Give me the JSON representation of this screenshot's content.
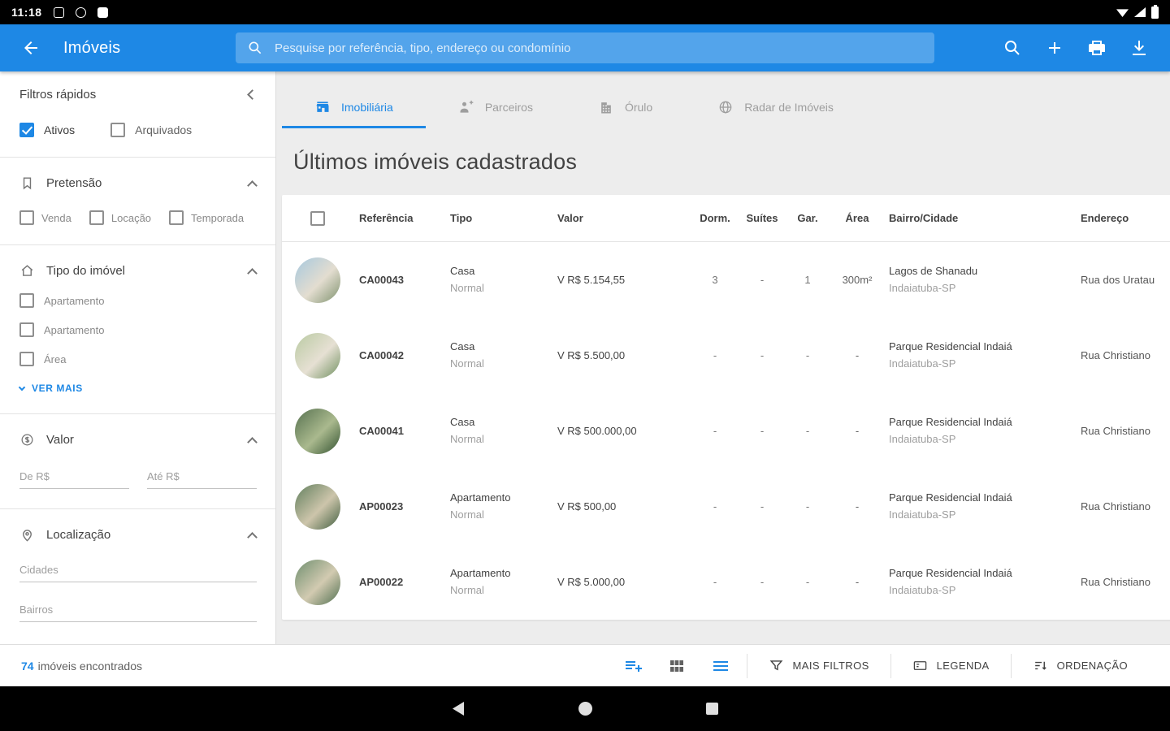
{
  "theme": {
    "accent": "#1e88e5",
    "bar_background": "#000000"
  },
  "status_bar": {
    "time": "11:18"
  },
  "app_bar": {
    "title": "Imóveis",
    "search_placeholder": "Pesquise por referência, tipo, endereço ou condomínio"
  },
  "sidebar": {
    "title": "Filtros rápidos",
    "quick_filters": [
      {
        "label": "Ativos",
        "checked": true
      },
      {
        "label": "Arquivados",
        "checked": false
      }
    ],
    "pretensao": {
      "title": "Pretensão",
      "options": [
        "Venda",
        "Locação",
        "Temporada"
      ]
    },
    "tipo_imovel": {
      "title": "Tipo do imóvel",
      "options": [
        "Apartamento",
        "Apartamento",
        "Área"
      ],
      "more": "VER MAIS"
    },
    "valor": {
      "title": "Valor",
      "from_placeholder": "De R$",
      "to_placeholder": "Até R$"
    },
    "localizacao": {
      "title": "Localização",
      "cidades_placeholder": "Cidades",
      "bairros_placeholder": "Bairros"
    }
  },
  "tabs": [
    {
      "label": "Imobiliária",
      "active": true
    },
    {
      "label": "Parceiros",
      "active": false
    },
    {
      "label": "Órulo",
      "active": false
    },
    {
      "label": "Radar de Imóveis",
      "active": false
    }
  ],
  "main": {
    "section_title": "Últimos imóveis cadastrados",
    "columns": {
      "ref": "Referência",
      "tipo": "Tipo",
      "valor": "Valor",
      "dorm": "Dorm.",
      "suites": "Suítes",
      "gar": "Gar.",
      "area": "Área",
      "bairro": "Bairro/Cidade",
      "endereco": "Endereço"
    },
    "rows": [
      {
        "ref": "CA00043",
        "tipo": "Casa",
        "tipo_sub": "Normal",
        "valor": "V R$ 5.154,55",
        "dorm": "3",
        "suites": "-",
        "gar": "1",
        "area": "300m²",
        "bairro": "Lagos de Shanadu",
        "cidade": "Indaiatuba-SP",
        "endereco": "Rua dos Uratau"
      },
      {
        "ref": "CA00042",
        "tipo": "Casa",
        "tipo_sub": "Normal",
        "valor": "V R$ 5.500,00",
        "dorm": "-",
        "suites": "-",
        "gar": "-",
        "area": "-",
        "bairro": "Parque Residencial Indaiá",
        "cidade": "Indaiatuba-SP",
        "endereco": "Rua Christiano"
      },
      {
        "ref": "CA00041",
        "tipo": "Casa",
        "tipo_sub": "Normal",
        "valor": "V R$ 500.000,00",
        "dorm": "-",
        "suites": "-",
        "gar": "-",
        "area": "-",
        "bairro": "Parque Residencial Indaiá",
        "cidade": "Indaiatuba-SP",
        "endereco": "Rua Christiano"
      },
      {
        "ref": "AP00023",
        "tipo": "Apartamento",
        "tipo_sub": "Normal",
        "valor": "V R$ 500,00",
        "dorm": "-",
        "suites": "-",
        "gar": "-",
        "area": "-",
        "bairro": "Parque Residencial Indaiá",
        "cidade": "Indaiatuba-SP",
        "endereco": "Rua Christiano"
      },
      {
        "ref": "AP00022",
        "tipo": "Apartamento",
        "tipo_sub": "Normal",
        "valor": "V R$ 5.000,00",
        "dorm": "-",
        "suites": "-",
        "gar": "-",
        "area": "-",
        "bairro": "Parque Residencial Indaiá",
        "cidade": "Indaiatuba-SP",
        "endereco": "Rua Christiano"
      }
    ]
  },
  "footer": {
    "count": "74",
    "count_label": "imóveis encontrados",
    "mais_filtros": "MAIS FILTROS",
    "legenda": "LEGENDA",
    "ordenacao": "ORDENAÇÃO"
  }
}
